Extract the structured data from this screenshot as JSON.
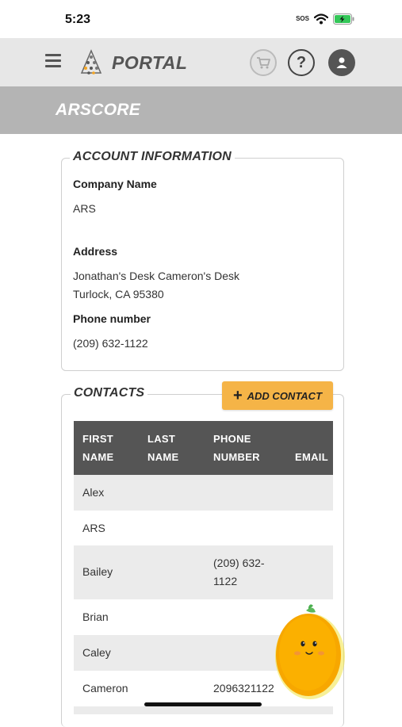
{
  "status_bar": {
    "time": "5:23",
    "sos": "SOS"
  },
  "header": {
    "brand": "PORTAL",
    "help_label": "?"
  },
  "band": {
    "title": "ARSCORE"
  },
  "account": {
    "legend": "ACCOUNT INFORMATION",
    "company_label": "Company Name",
    "company_value": "ARS",
    "address_label": "Address",
    "address_line1": "Jonathan's Desk Cameron's Desk",
    "address_line2": "Turlock, CA 95380",
    "phone_label": "Phone number",
    "phone_value": "(209) 632-1122"
  },
  "contacts": {
    "legend": "CONTACTS",
    "add_button": "ADD CONTACT",
    "add_icon": "+",
    "columns": {
      "first_l1": "FIRST",
      "first_l2": "NAME",
      "last_l1": "LAST",
      "last_l2": "NAME",
      "phone_l1": "PHONE",
      "phone_l2": "NUMBER",
      "email": "EMAIL"
    },
    "rows": [
      {
        "first": "Alex",
        "last": "",
        "phone_l1": "",
        "phone_l2": ""
      },
      {
        "first": "ARS",
        "last": "",
        "phone_l1": "",
        "phone_l2": ""
      },
      {
        "first": "Bailey",
        "last": "",
        "phone_l1": "(209) 632-",
        "phone_l2": "1122"
      },
      {
        "first": "Brian",
        "last": "",
        "phone_l1": "",
        "phone_l2": ""
      },
      {
        "first": "Caley",
        "last": "",
        "phone_l1": "",
        "phone_l2": ""
      },
      {
        "first": "Cameron",
        "last": "",
        "phone_l1": "2096321122",
        "phone_l2": ""
      }
    ]
  },
  "colors": {
    "accent": "#f5b447",
    "header_bg": "#e7e7e7",
    "band_bg": "#b4b4b4",
    "table_head": "#555555",
    "stripe": "#ebebeb"
  }
}
